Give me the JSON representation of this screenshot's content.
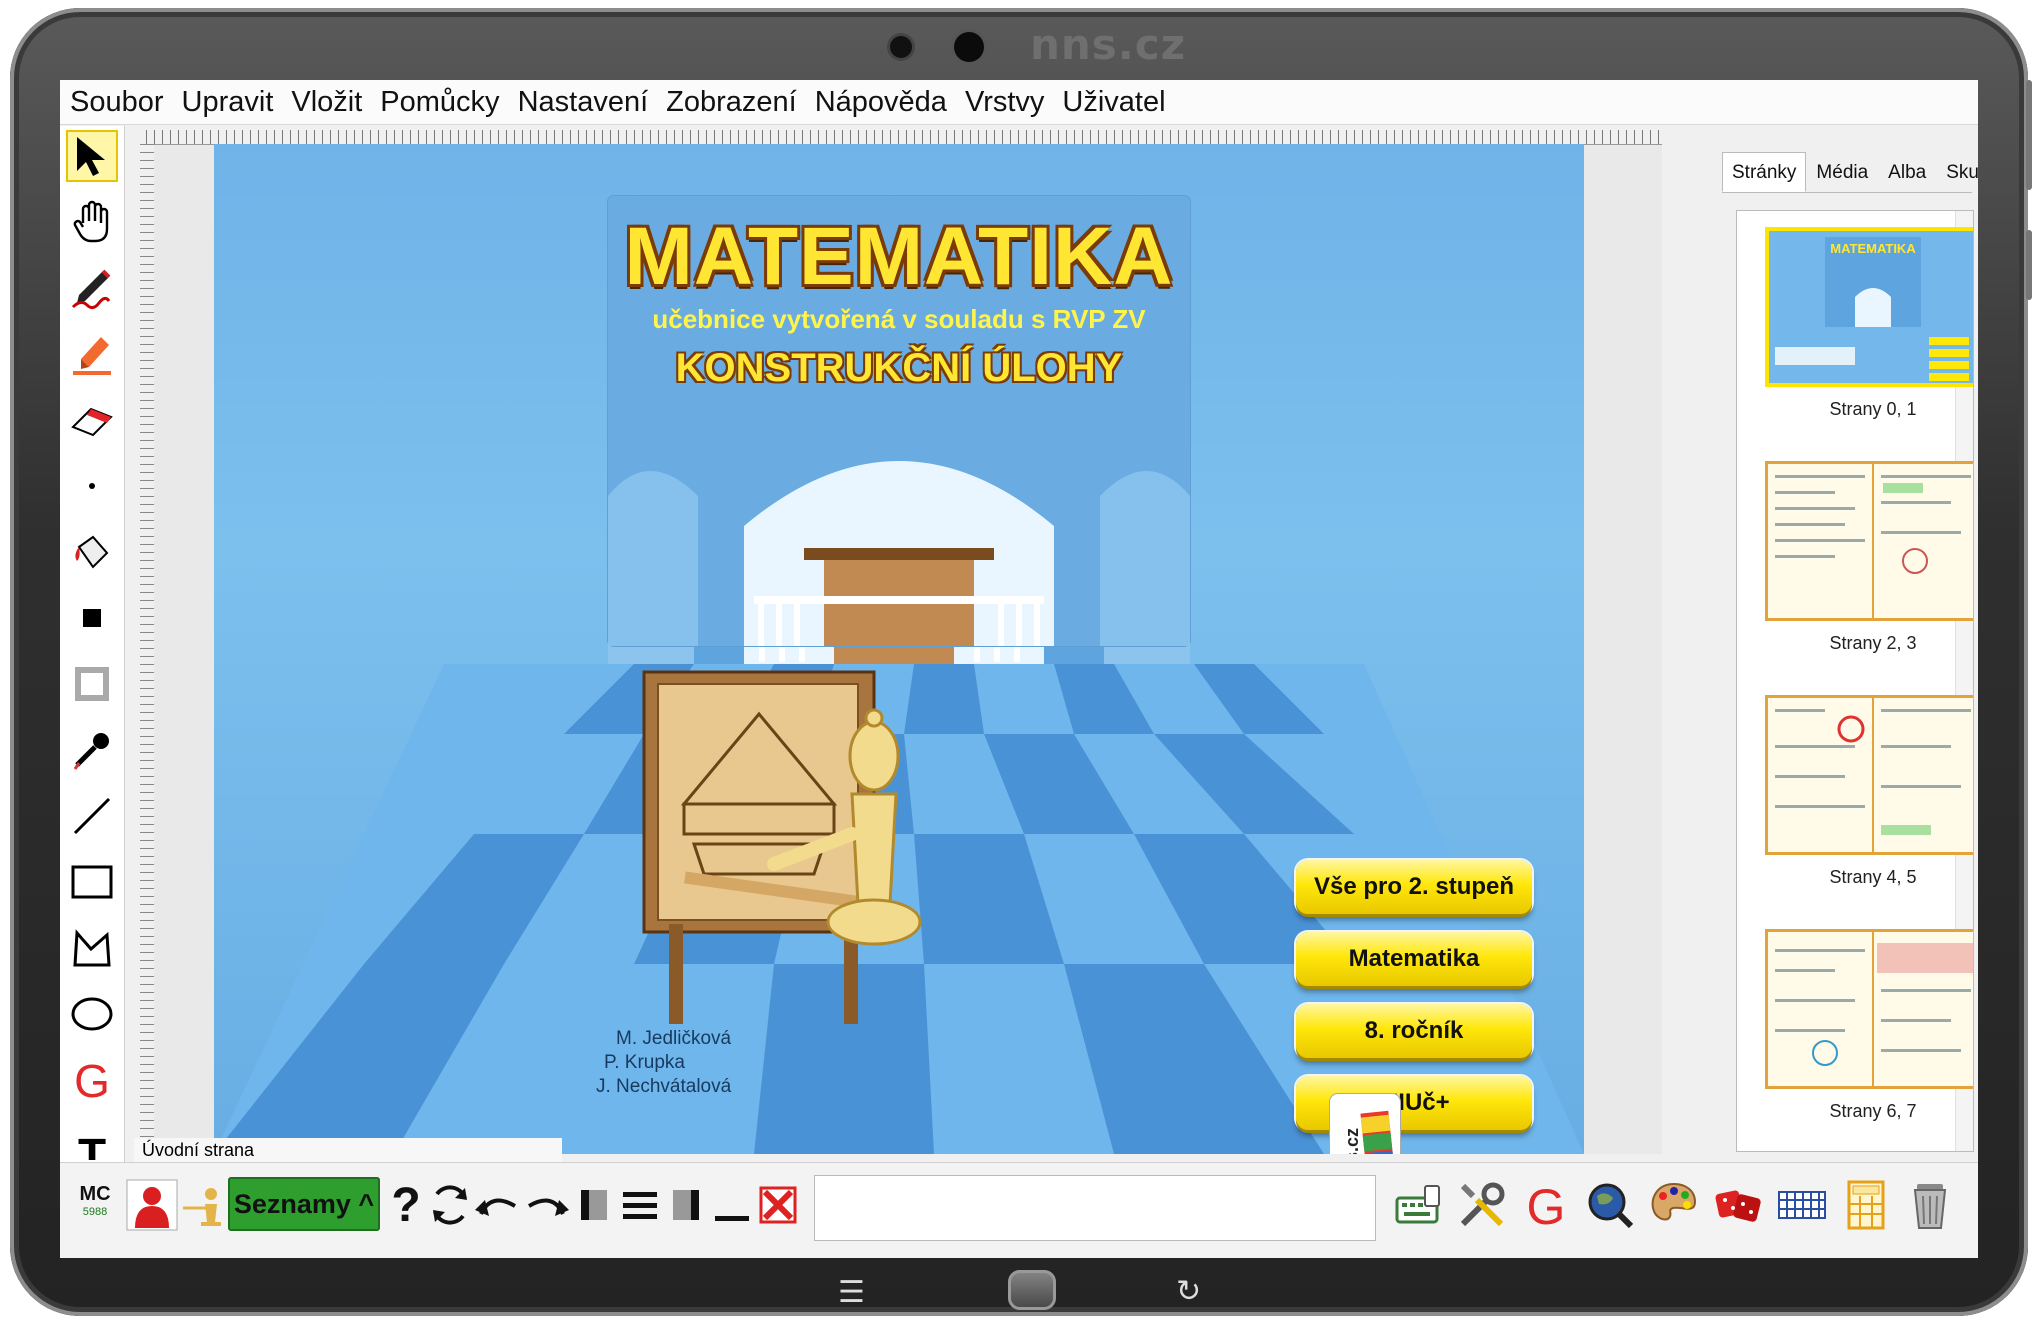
{
  "device": {
    "brand": "nns.cz"
  },
  "menu": [
    "Soubor",
    "Upravit",
    "Vložit",
    "Pomůcky",
    "Nastavení",
    "Zobrazení",
    "Nápověda",
    "Vrstvy",
    "Uživatel"
  ],
  "left_tools": [
    "select-arrow",
    "pan-hand",
    "pen",
    "highlighter",
    "eraser",
    "dot",
    "fill-bucket",
    "filled-square",
    "hollow-square",
    "eyedropper",
    "line",
    "rectangle",
    "polygon",
    "ellipse",
    "geogebra",
    "text"
  ],
  "page": {
    "title": "MATEMATIKA",
    "subtitle": "učebnice vytvořená v souladu s RVP ZV",
    "subtitle2": "KONSTRUKČNÍ ÚLOHY",
    "authors": [
      "M. Jedličková",
      "P. Krupka",
      "J. Nechvátalová"
    ],
    "publisher_logo_text": "nns.cz",
    "nav_buttons": [
      "Vše pro 2. stupeň",
      "Matematika",
      "8. ročník",
      "MIUč+"
    ],
    "label": "Úvodní strana"
  },
  "right_panel": {
    "tabs": [
      "Stránky",
      "Média",
      "Alba",
      "Skupiny"
    ],
    "active_tab": "Stránky",
    "thumbnails": [
      {
        "label": "Strany 0, 1",
        "selected": true
      },
      {
        "label": "Strany 2, 3"
      },
      {
        "label": "Strany 4, 5"
      },
      {
        "label": "Strany 6, 7"
      }
    ]
  },
  "bottom_bar": {
    "mc_label": "MC",
    "mc_number": "5988",
    "lists_button": "Seznamy ^",
    "help_glyph": "?",
    "text_field_value": "",
    "right_icons": [
      "keyboard-icon",
      "tools-icon",
      "geogebra-icon",
      "globe-search-icon",
      "palette-icon",
      "dice-icon",
      "grid-keyboard-icon",
      "calculator-icon",
      "trash-icon"
    ]
  },
  "colors": {
    "accent_button": "#ffe70a",
    "lists_green": "#2e9e2e",
    "page_blue": "#6fb3e8",
    "title_yellow": "#ffe633"
  }
}
